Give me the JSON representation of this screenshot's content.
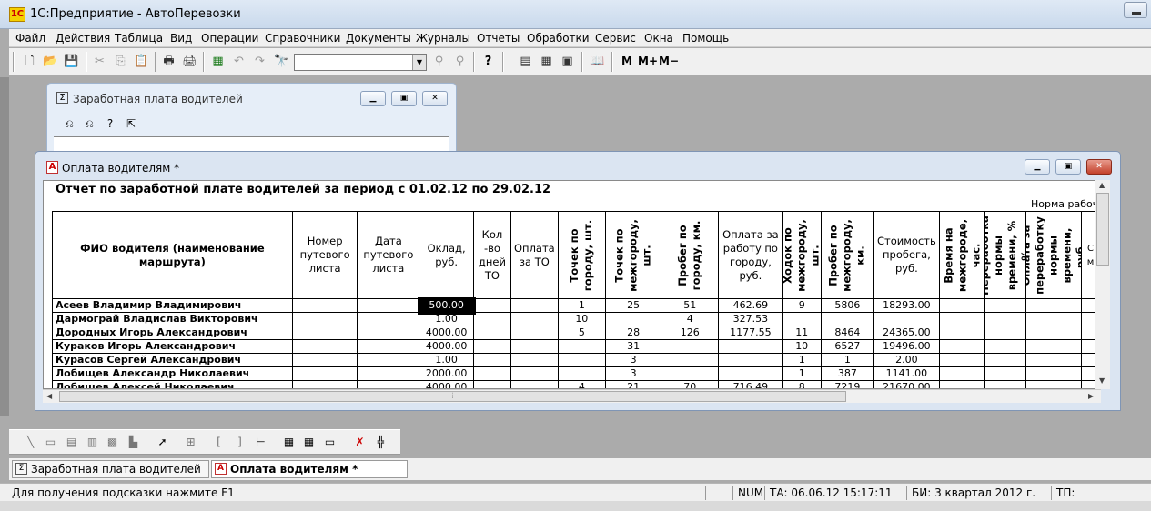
{
  "app": {
    "title": "1С:Предприятие - АвтоПеревозки"
  },
  "menu": [
    "Файл",
    "Действия",
    "Таблица",
    "Вид",
    "Операции",
    "Справочники",
    "Документы",
    "Журналы",
    "Отчеты",
    "Обработки",
    "Сервис",
    "Окна",
    "Помощь"
  ],
  "toolbar": {
    "combo_value": "",
    "m": "М",
    "m_plus": "М+",
    "m_minus": "М−"
  },
  "window1": {
    "title": "Заработная плата водителей"
  },
  "window2": {
    "title": "Оплата водителям  *",
    "report_title": "Отчет по заработной плате водителей за период с 01.02.12 по 29.02.12",
    "norm_label": "Норма рабочег",
    "headers": {
      "name": "ФИО водителя (наименование маршрута)",
      "waybill_no": "Номер путевого листа",
      "waybill_date": "Дата путевого листа",
      "salary": "Оклад, руб.",
      "days_to": "Кол -во дней ТО",
      "pay_to": "Оплата за ТО",
      "city_points": "Точек по городу, шт.",
      "intercity_points": "Точек по межгороду, шт.",
      "city_mileage": "Пробег по городу, км.",
      "city_pay": "Оплата за работу по городу, руб.",
      "intercity_trips": "Ходок по межгороду, шт.",
      "intercity_mileage": "Пробег по межгороду, км.",
      "mileage_cost": "Стоимость пробега, руб.",
      "intercity_time": "Время на межгороде, час.",
      "overtime": "Переработка нормы времени, % %",
      "overtime_pay": "Оплата за переработку нормы времени, руб.",
      "extra": "С м"
    },
    "rows": [
      {
        "name": "Асеев Владимир Владимирович",
        "salary": "500.00",
        "city_points": "1",
        "intercity_points": "25",
        "city_mileage": "51",
        "city_pay": "462.69",
        "intercity_trips": "9",
        "intercity_mileage": "5806",
        "mileage_cost": "18293.00"
      },
      {
        "name": "Дармограй Владислав Викторович",
        "salary": "1.00",
        "city_points": "10",
        "intercity_points": "",
        "city_mileage": "4",
        "city_pay": "327.53",
        "intercity_trips": "",
        "intercity_mileage": "",
        "mileage_cost": ""
      },
      {
        "name": "Дородных Игорь Александрович",
        "salary": "4000.00",
        "city_points": "5",
        "intercity_points": "28",
        "city_mileage": "126",
        "city_pay": "1177.55",
        "intercity_trips": "11",
        "intercity_mileage": "8464",
        "mileage_cost": "24365.00"
      },
      {
        "name": "Кураков Игорь Александрович",
        "salary": "4000.00",
        "city_points": "",
        "intercity_points": "31",
        "city_mileage": "",
        "city_pay": "",
        "intercity_trips": "10",
        "intercity_mileage": "6527",
        "mileage_cost": "19496.00"
      },
      {
        "name": "Курасов Сергей Александрович",
        "salary": "1.00",
        "city_points": "",
        "intercity_points": "3",
        "city_mileage": "",
        "city_pay": "",
        "intercity_trips": "1",
        "intercity_mileage": "1",
        "mileage_cost": "2.00"
      },
      {
        "name": "Лобищев Александр Николаевич",
        "salary": "2000.00",
        "city_points": "",
        "intercity_points": "3",
        "city_mileage": "",
        "city_pay": "",
        "intercity_trips": "1",
        "intercity_mileage": "387",
        "mileage_cost": "1141.00"
      },
      {
        "name": "Лобищев Алексей Николаевич",
        "salary": "4000.00",
        "city_points": "4",
        "intercity_points": "21",
        "city_mileage": "70",
        "city_pay": "716.49",
        "intercity_trips": "8",
        "intercity_mileage": "7219",
        "mileage_cost": "21670.00"
      }
    ],
    "selected_row": 0
  },
  "taskbar": [
    {
      "label": "Заработная плата водителей",
      "active": false
    },
    {
      "label": "Оплата водителям  *",
      "active": true
    }
  ],
  "status": {
    "hint": "Для получения подсказки нажмите F1",
    "num": "NUM",
    "ta": "ТА: 06.06.12  15:17:11",
    "bi": "БИ: 3 квартал 2012 г.",
    "tp": "ТП:"
  }
}
